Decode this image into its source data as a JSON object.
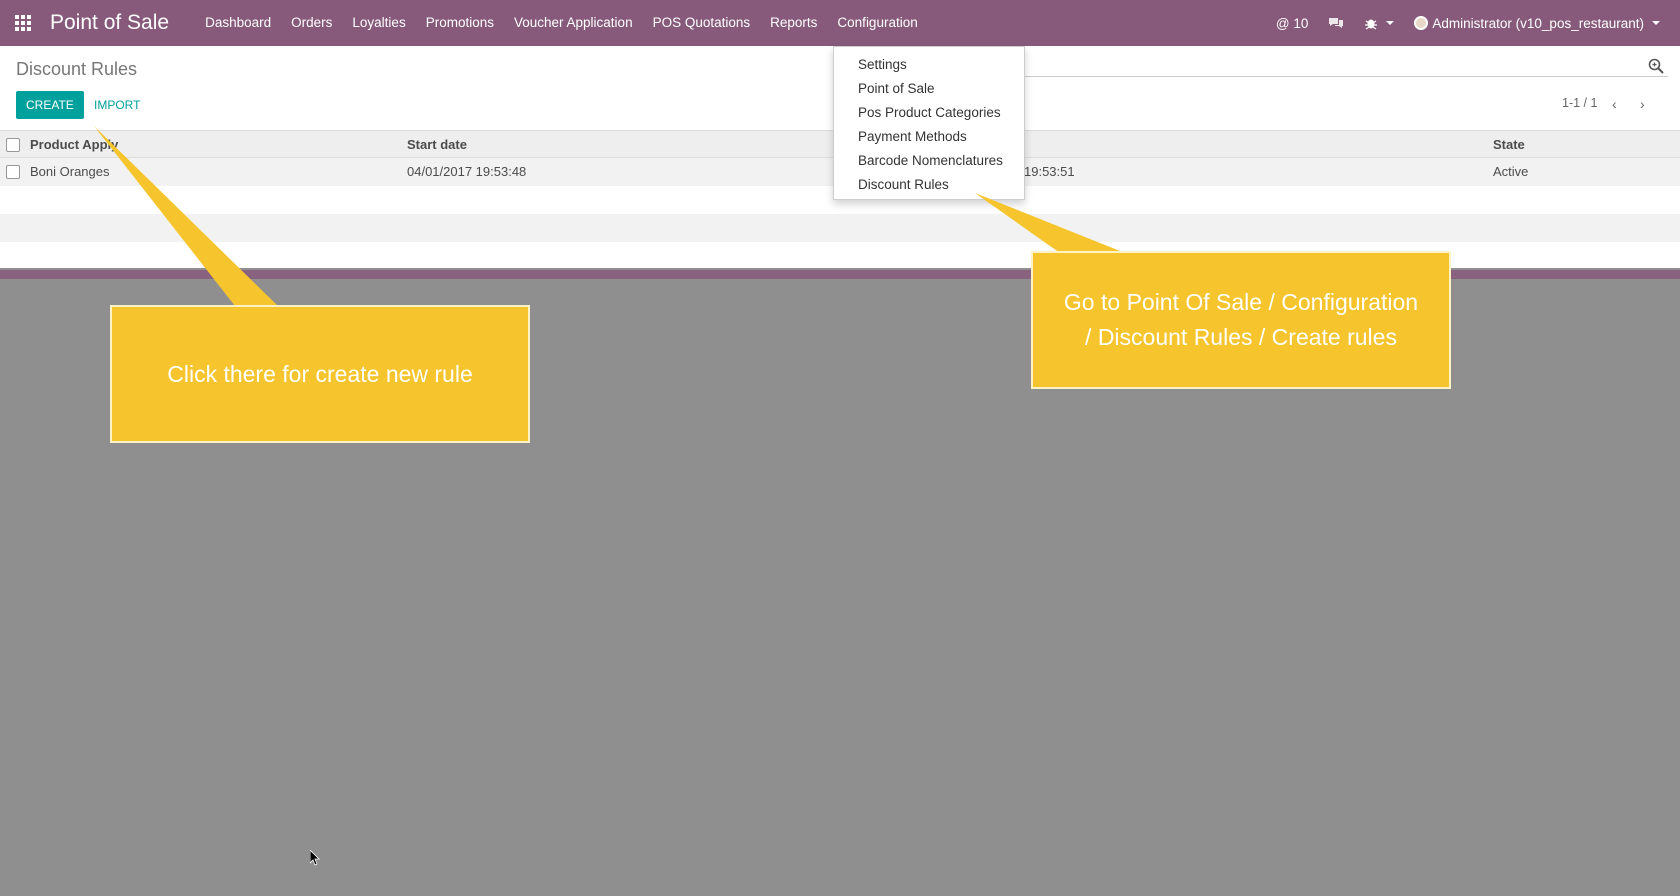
{
  "navbar": {
    "brand": "Point of Sale",
    "menu": [
      "Dashboard",
      "Orders",
      "Loyalties",
      "Promotions",
      "Voucher Application",
      "POS Quotations",
      "Reports",
      "Configuration"
    ],
    "notifications": "@ 10",
    "user": "Administrator (v10_pos_restaurant)",
    "bar_color": "#875a7b"
  },
  "page": {
    "title": "Discount Rules",
    "create_label": "CREATE",
    "import_label": "IMPORT",
    "pager": "1-1 / 1",
    "accent_color": "#00a09d"
  },
  "table": {
    "headers": {
      "product": "Product Apply",
      "start_date": "Start date",
      "state": "State"
    },
    "rows": [
      {
        "product": "Boni Oranges",
        "start_date": "04/01/2017 19:53:48",
        "end_date_fragment": "19:53:51",
        "state": "Active"
      }
    ]
  },
  "config_menu": {
    "items": [
      "Settings",
      "Point of Sale",
      "Pos Product Categories",
      "Payment Methods",
      "Barcode Nomenclatures",
      "Discount Rules"
    ]
  },
  "callouts": {
    "left": "Click there for create new rule",
    "right": "Go to Point Of Sale / Configuration / Discount Rules / Create rules",
    "color": "#f6c42c"
  }
}
